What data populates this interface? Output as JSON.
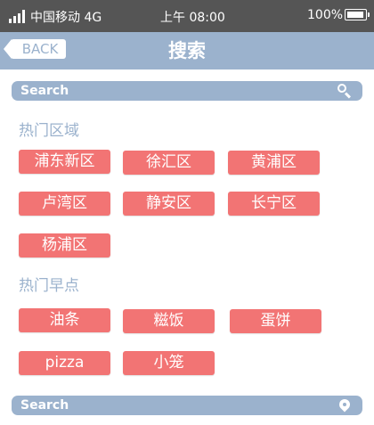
{
  "status_bar": {
    "carrier": "中国移动 4G",
    "time": "上午 08:00",
    "battery": "100%"
  },
  "nav": {
    "back_label": "BACK",
    "title": "搜索"
  },
  "search_top": {
    "placeholder": "Search",
    "icon": "search-icon"
  },
  "hot_areas": {
    "title": "热门区域",
    "items": [
      "浦东新区",
      "徐汇区",
      "黄浦区",
      "卢湾区",
      "静安区",
      "长宁区",
      "杨浦区"
    ]
  },
  "hot_breakfast": {
    "title": "热门早点",
    "items": [
      "油条",
      "糍饭",
      "蛋饼",
      "pizza",
      "小笼"
    ]
  },
  "search_bottom": {
    "placeholder": "Search",
    "icon": "location-pin-icon"
  },
  "colors": {
    "accent": "#9bb2cd",
    "tag": "#f27474",
    "status_bar": "#555555"
  }
}
